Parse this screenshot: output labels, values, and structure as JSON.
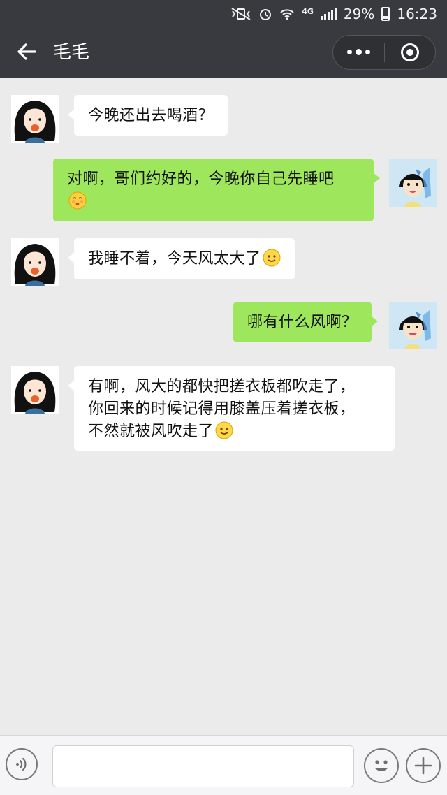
{
  "status_bar": {
    "battery": "29%",
    "time": "16:23",
    "network": "4G"
  },
  "header": {
    "title": "毛毛"
  },
  "messages": [
    {
      "side": "left",
      "text": "今晚还出去喝酒？",
      "emoji": ""
    },
    {
      "side": "right",
      "text": "对啊，哥们约好的，今晚你自己先睡吧",
      "emoji": "kiss-face"
    },
    {
      "side": "left",
      "text": "我睡不着，今天风太大了",
      "emoji": "smile-face"
    },
    {
      "side": "right",
      "text": "哪有什么风啊？",
      "emoji": ""
    },
    {
      "side": "left",
      "lines": [
        "有啊，风大的都快把搓衣板都吹走了，",
        "你回来的时候记得用膝盖压着搓衣板，",
        "不然就被风吹走了"
      ],
      "emoji": "smile-face"
    }
  ],
  "input": {
    "value": "",
    "placeholder": ""
  },
  "colors": {
    "topbar": "#393a3f",
    "background": "#ebebeb",
    "bubble_self": "#9ee65c",
    "bubble_other": "#ffffff"
  }
}
